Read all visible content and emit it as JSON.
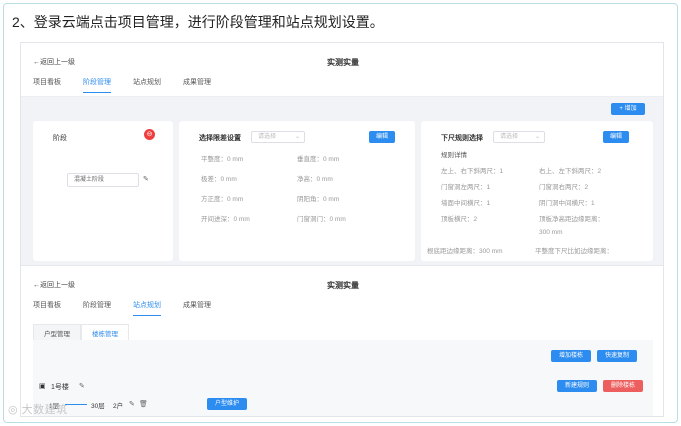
{
  "heading": "2、登录云端点击项目管理，进行阶段管理和站点规划设置。",
  "panel1": {
    "back": "←返回上一级",
    "title": "实测实量",
    "tabs": [
      "项目看板",
      "阶段管理",
      "站点规划",
      "成果管理"
    ],
    "add_button": "+ 增加",
    "stage_card": {
      "title": "阶段",
      "badge": "⊖",
      "input_value": "混凝土阶段",
      "edit_icon": "pencil-icon"
    },
    "tolerance_card": {
      "title": "选择限差设置",
      "select_placeholder": "请选择",
      "edit_button": "编辑",
      "fields": [
        "平整度：0 mm",
        "垂直度：0 mm",
        "极差：0 mm",
        "净高：0 mm",
        "方正度：0 mm",
        "阴阳角：0 mm",
        "开间进深：0 mm",
        "门窗洞门：0 mm"
      ]
    },
    "ruler_card": {
      "title": "下尺规则选择",
      "select_placeholder": "请选择",
      "edit_button": "编辑",
      "subtitle": "规则详情",
      "fields": [
        "左上、右下斜两尺：1",
        "右上、左下斜两尺：2",
        "门窗洞左两尺：1",
        "门窗洞右两尺：2",
        "墙面中间横尺：1",
        "阴门洞中间横尺：1",
        "顶板横尺：2",
        "顶板净高距边缘距离：",
        "300 mm",
        "根底距边缘距离：300 mm",
        "平整度下尺比如边缘距离："
      ]
    }
  },
  "panel2": {
    "back": "←返回上一级",
    "title": "实测实量",
    "tabs": [
      "项目看板",
      "阶段管理",
      "站点规划",
      "成果管理"
    ],
    "subtabs": [
      "户型管理",
      "楼栋管理"
    ],
    "buttons": [
      "增加楼栋",
      "快速复制"
    ],
    "building": {
      "name": "1号楼",
      "floor_start": "1层",
      "floor_end": "30层",
      "units": "2户",
      "unit_button": "户型维护",
      "new_rule_button": "新建规则",
      "delete_button": "删除楼栋"
    }
  },
  "watermark": "◎ 大数建筑",
  "colors": {
    "accent": "#2d8cf0",
    "danger": "#ed5e5e",
    "border": "#b9dfe6"
  }
}
